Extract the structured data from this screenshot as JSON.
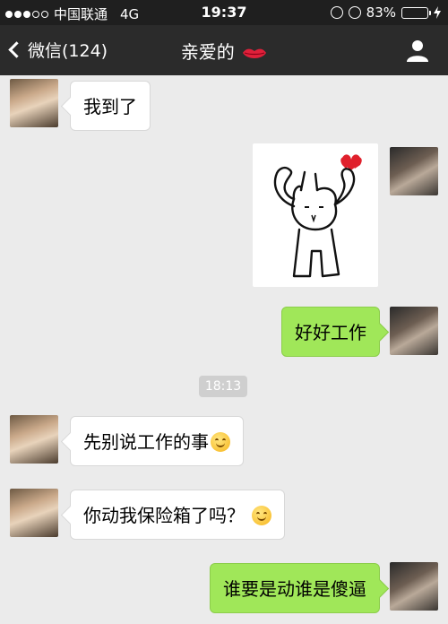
{
  "status_bar": {
    "carrier": "中国联通",
    "network": "4G",
    "time": "19:37",
    "battery": "83%",
    "battery_level": 0.83,
    "battery_color": "#4cd964"
  },
  "nav": {
    "back_label": "微信(124)",
    "title": "亲爱的",
    "title_icon": "lips-icon",
    "right_icon": "person-icon"
  },
  "messages": [
    {
      "side": "in",
      "type": "text",
      "text": "我到了"
    },
    {
      "side": "out",
      "type": "sticker",
      "sticker": "rabbit-heart-sticker"
    },
    {
      "side": "out",
      "type": "text",
      "text": "好好工作"
    },
    {
      "side": "in",
      "type": "text",
      "text": "先别说工作的事",
      "emoji": "smile-emoji"
    },
    {
      "side": "in",
      "type": "text",
      "text": "你动我保险箱了吗？",
      "emoji": "smile-emoji"
    },
    {
      "side": "out",
      "type": "text",
      "text": "谁要是动谁是傻逼"
    }
  ],
  "timestamp": "18:13",
  "colors": {
    "navbar": "#2b2b2b",
    "chat_bg": "#ebebeb",
    "out_bubble": "#a0e759",
    "in_bubble": "#ffffff"
  }
}
